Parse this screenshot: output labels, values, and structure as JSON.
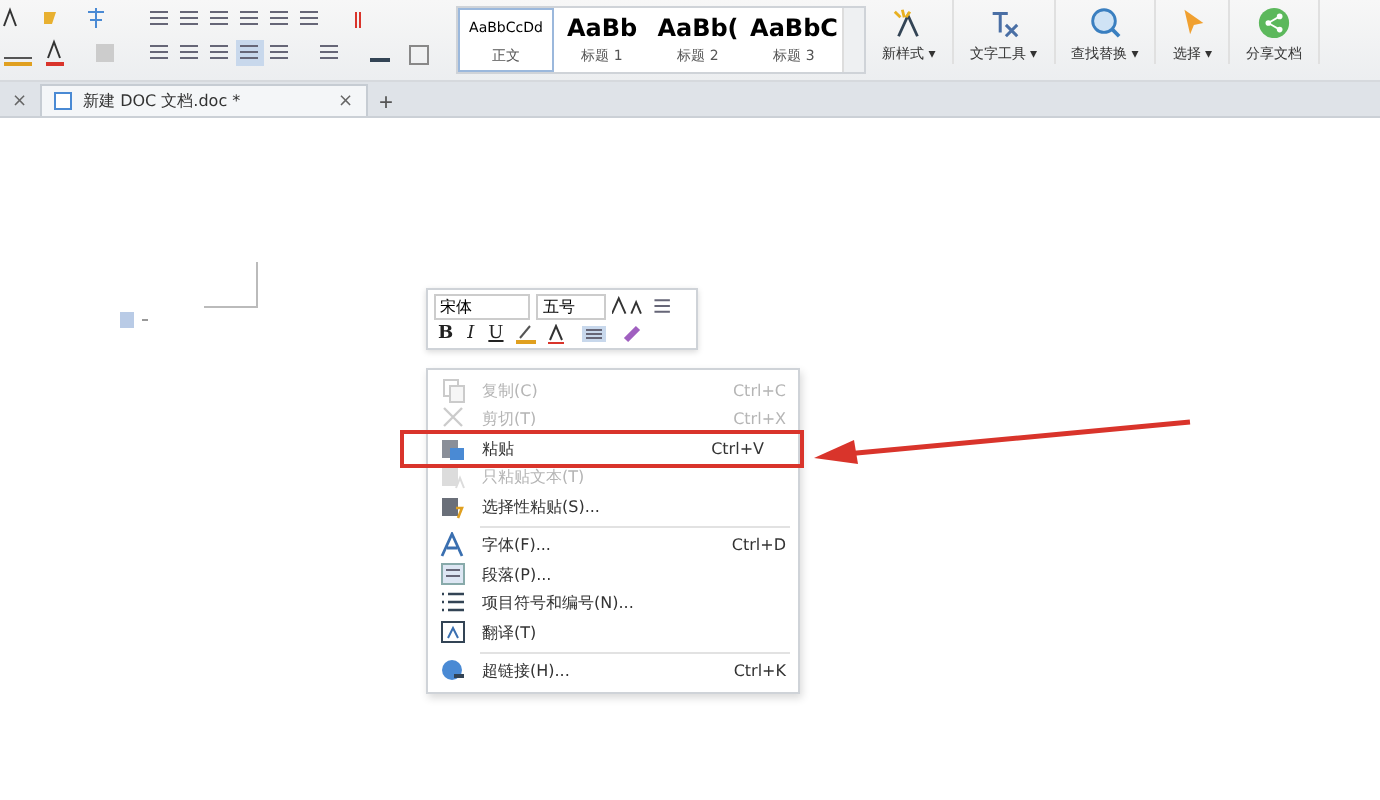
{
  "ribbon": {
    "styles": [
      {
        "sample": "AaBbCcDd",
        "label": "正文",
        "selected": true
      },
      {
        "sample": "AaBb",
        "label": "标题 1",
        "selected": false
      },
      {
        "sample": "AaBb(",
        "label": "标题 2",
        "selected": false
      },
      {
        "sample": "AaBbC",
        "label": "标题 3",
        "selected": false
      }
    ],
    "buttons": [
      {
        "label": "新样式 ▾"
      },
      {
        "label": "文字工具 ▾"
      },
      {
        "label": "查找替换 ▾"
      },
      {
        "label": "选择 ▾"
      },
      {
        "label": "分享文档"
      }
    ]
  },
  "tabs": [
    {
      "close": "×",
      "selected": false
    },
    {
      "label": "新建 DOC 文档.doc *",
      "close": "×",
      "selected": true
    }
  ],
  "new_tab": "+",
  "mini_toolbar": {
    "font": "宋体",
    "size": "五号",
    "bold": "B",
    "italic": "I",
    "underline": "U"
  },
  "context_menu": [
    {
      "kind": "item",
      "label": "复制(C)",
      "shortcut": "Ctrl+C",
      "disabled": true,
      "highlighted": false
    },
    {
      "kind": "item",
      "label": "剪切(T)",
      "shortcut": "Ctrl+X",
      "disabled": true,
      "highlighted": false
    },
    {
      "kind": "item",
      "label": "粘贴",
      "shortcut": "Ctrl+V",
      "disabled": false,
      "highlighted": true
    },
    {
      "kind": "item",
      "label": "只粘贴文本(T)",
      "disabled": true,
      "highlighted": false
    },
    {
      "kind": "item",
      "label": "选择性粘贴(S)...",
      "disabled": false,
      "highlighted": false
    },
    {
      "kind": "separator"
    },
    {
      "kind": "item",
      "label": "字体(F)...",
      "shortcut": "Ctrl+D",
      "disabled": false,
      "highlighted": false
    },
    {
      "kind": "item",
      "label": "段落(P)...",
      "disabled": false,
      "highlighted": false
    },
    {
      "kind": "item",
      "label": "项目符号和编号(N)...",
      "disabled": false,
      "highlighted": false
    },
    {
      "kind": "item",
      "label": "翻译(T)",
      "disabled": false,
      "highlighted": false
    },
    {
      "kind": "separator"
    },
    {
      "kind": "item",
      "label": "超链接(H)...",
      "shortcut": "Ctrl+K",
      "disabled": false,
      "highlighted": false
    }
  ]
}
